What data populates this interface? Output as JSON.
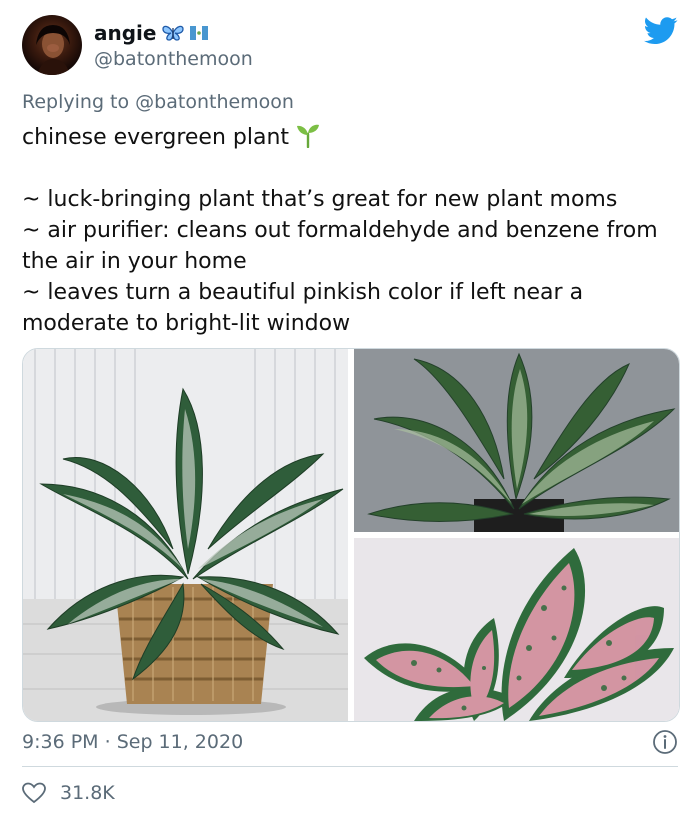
{
  "author": {
    "display_name": "angie",
    "handle": "@batonthemoon",
    "badges": [
      "butterfly-icon",
      "guatemala-flag-icon"
    ]
  },
  "reply": {
    "prefix": "Replying to",
    "mention": "@batonthemoon"
  },
  "tweet": {
    "title": "chinese evergreen plant",
    "lines": [
      "~ luck-bringing plant that’s great for new plant moms",
      "~ air purifier: cleans out formaldehyde and benzene from the air in your home",
      "~ leaves turn a beautiful pinkish color if left near a moderate to bright-lit window"
    ]
  },
  "meta": {
    "time": "9:36 PM",
    "separator": "·",
    "date": "Sep 11, 2020"
  },
  "stats": {
    "likes": "31.8K"
  },
  "colors": {
    "brand": "#1d9bf0",
    "secondary_text": "#5b6b78",
    "divider": "#cfd9de"
  }
}
